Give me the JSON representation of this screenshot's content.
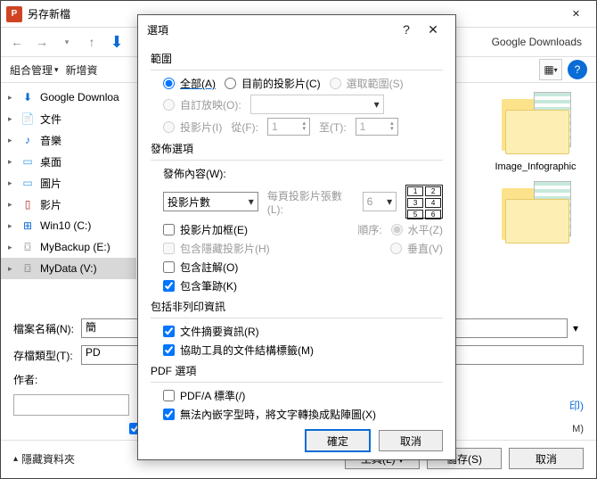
{
  "outer": {
    "title": "另存新檔",
    "address_tail": "Google Downloads",
    "toolbar": {
      "organize": "組合管理",
      "newfolder": "新增資"
    },
    "nav": [
      {
        "icon": "⬇",
        "color": "#0a6cd6",
        "label": "Google Downloa"
      },
      {
        "icon": "📄",
        "color": "#444",
        "label": "文件"
      },
      {
        "icon": "♪",
        "color": "#0a6cd6",
        "label": "音樂"
      },
      {
        "icon": "▭",
        "color": "#3aa0e8",
        "label": "桌面"
      },
      {
        "icon": "▭",
        "color": "#3aa0e8",
        "label": "圖片"
      },
      {
        "icon": "▯",
        "color": "#b02a2a",
        "label": "影片"
      },
      {
        "icon": "⊞",
        "color": "#0a6cd6",
        "label": "Win10 (C:)"
      },
      {
        "icon": "⌼",
        "color": "#666",
        "label": "MyBackup (E:)"
      },
      {
        "icon": "⌼",
        "color": "#666",
        "label": "MyData (V:)",
        "selected": true
      }
    ],
    "folders": [
      {
        "label": "Image_Infographic"
      },
      {
        "label": ""
      }
    ],
    "filename_label": "檔案名稱(N):",
    "filename_value": "簡",
    "filetype_label": "存檔類型(T):",
    "filetype_value": "PD",
    "author_label": "作者:",
    "tools_label": "工具(L)",
    "save_label": "儲存(S)",
    "cancel_label": "取消",
    "hidefolders": "隱藏資料夾",
    "partial_text": "印)"
  },
  "modal": {
    "title": "選項",
    "s_range": "範圍",
    "r_all": "全部(A)",
    "r_current": "目前的投影片(C)",
    "r_selection": "選取範圍(S)",
    "r_custom": "自訂放映(O):",
    "r_slides": "投影片(I)",
    "from_label": "從(F):",
    "to_label": "至(T):",
    "from_val": "1",
    "to_val": "1",
    "s_publish": "發佈選項",
    "publish_what": "發佈內容(W):",
    "publish_value": "投影片數",
    "per_page": "每頁投影片張數(L):",
    "per_page_value": "6",
    "order_label": "順序:",
    "order_h": "水平(Z)",
    "order_v": "垂直(V)",
    "cb_frame": "投影片加框(E)",
    "cb_hidden": "包含隱藏投影片(H)",
    "cb_comments": "包含註解(O)",
    "cb_ink": "包含筆跡(K)",
    "s_nonprint": "包括非列印資訊",
    "cb_props": "文件摘要資訊(R)",
    "cb_a11y": "協助工具的文件結構標籤(M)",
    "s_pdf": "PDF 選項",
    "cb_pdfa": "PDF/A 標準(/)",
    "cb_bitmap": "無法內嵌字型時，將文字轉換成點陣圖(X)",
    "ok": "確定",
    "cancel": "取消"
  }
}
